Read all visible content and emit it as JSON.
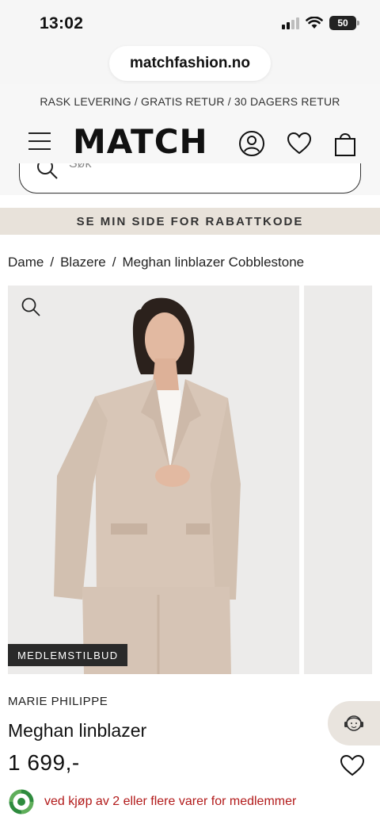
{
  "status_bar": {
    "time": "13:02",
    "battery": "50"
  },
  "browser": {
    "url": "matchfashion.no"
  },
  "header": {
    "promo_text": "RASK LEVERING / GRATIS RETUR / 30 DAGERS RETUR",
    "logo": "MATCH",
    "search_placeholder": "Søk",
    "menu_icon": "hamburger-icon",
    "account_icon": "user-icon",
    "wishlist_icon": "heart-icon",
    "cart_icon": "shopping-bag-icon"
  },
  "discount_banner": "SE MIN SIDE FOR RABATTKODE",
  "breadcrumb": [
    "Dame",
    "Blazere",
    "Meghan linblazer Cobblestone"
  ],
  "product": {
    "badge": "MEDLEMSTILBUD",
    "brand": "MARIE PHILIPPE",
    "name": "Meghan linblazer",
    "price": "1 699,-",
    "member_offer": "ved kjøp av 2 eller flere varer for medlemmer"
  },
  "colors": {
    "banner_bg": "#e8e2da",
    "offer_red": "#b21a1a",
    "offer_icon_green": "#2e8b3e"
  }
}
